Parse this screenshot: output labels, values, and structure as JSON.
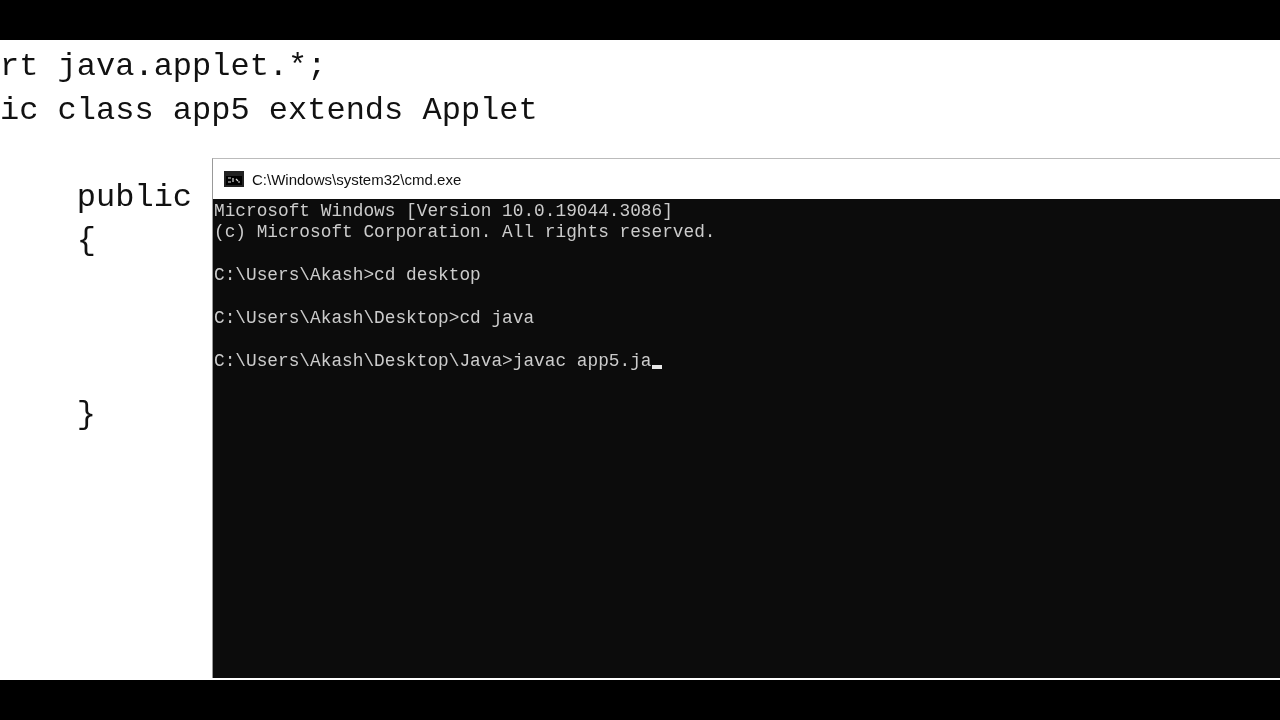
{
  "editor": {
    "lines": [
      {
        "kind": "code",
        "text": "rt java.applet.*;"
      },
      {
        "kind": "code",
        "text": "ic class app5 extends Applet"
      },
      {
        "kind": "blank"
      },
      {
        "kind": "code",
        "text": "    public"
      },
      {
        "kind": "code",
        "text": "    {"
      },
      {
        "kind": "blank"
      },
      {
        "kind": "blank"
      },
      {
        "kind": "blank"
      },
      {
        "kind": "code",
        "text": "    }"
      }
    ]
  },
  "console": {
    "title": "C:\\Windows\\system32\\cmd.exe",
    "lines": [
      {
        "kind": "output",
        "text": "Microsoft Windows [Version 10.0.19044.3086]"
      },
      {
        "kind": "output",
        "text": "(c) Microsoft Corporation. All rights reserved."
      },
      {
        "kind": "blank"
      },
      {
        "kind": "prompt",
        "text": "C:\\Users\\Akash>cd desktop"
      },
      {
        "kind": "blank"
      },
      {
        "kind": "prompt",
        "text": "C:\\Users\\Akash\\Desktop>cd java"
      },
      {
        "kind": "blank"
      },
      {
        "kind": "prompt",
        "text": "C:\\Users\\Akash\\Desktop\\Java>javac app5.ja",
        "cursor": true
      }
    ]
  }
}
